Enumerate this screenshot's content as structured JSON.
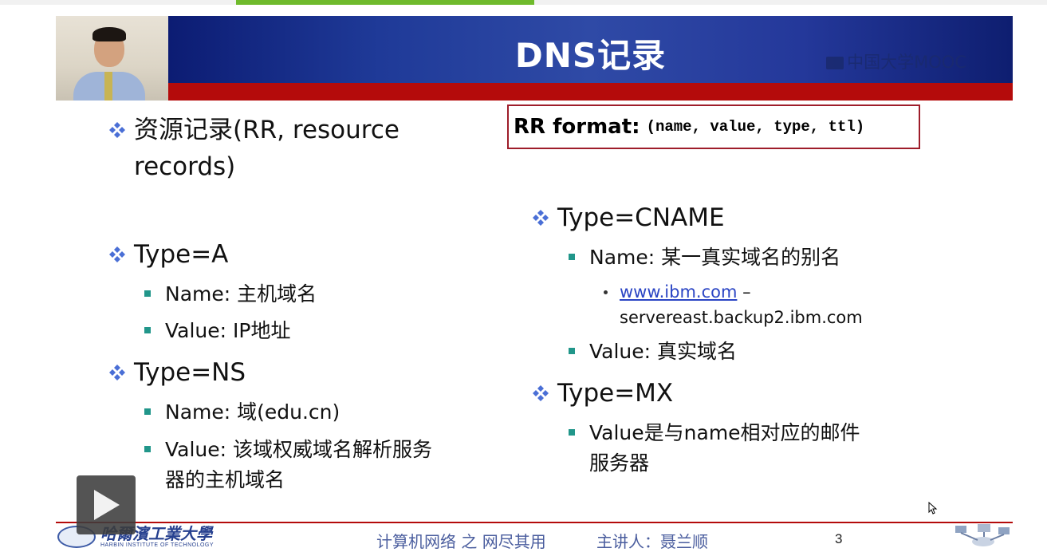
{
  "slide": {
    "title": "DNS记录",
    "watermark": "中国大学MOOC",
    "rr_format": {
      "label": "RR format:",
      "code": "(name, value, type, ttl)"
    },
    "left": {
      "rr_line1": "资源记录(RR, resource",
      "rr_line2": "records)",
      "type_a": "Type=A",
      "type_a_name": "Name: 主机域名",
      "type_a_value": "Value: IP地址",
      "type_ns": "Type=NS",
      "type_ns_name": "Name: 域(edu.cn)",
      "type_ns_value_line1": "Value: 该域权威域名解析服务",
      "type_ns_value_line2": "器的主机域名"
    },
    "right": {
      "type_cname": "Type=CNAME",
      "type_cname_name": "Name: 某一真实域名的别名",
      "example_link": "www.ibm.com",
      "example_dash": " –",
      "example_target": "servereast.backup2.ibm.com",
      "type_cname_value": "Value: 真实域名",
      "type_mx": "Type=MX",
      "type_mx_value_line1": "Value是与name相对应的邮件",
      "type_mx_value_line2": "服务器"
    },
    "footer": {
      "university_zh": "哈爾濱工業大學",
      "university_en": "HARBIN INSTITUTE OF TECHNOLOGY",
      "course": "计算机网络 之 网尽其用",
      "presenter": "主讲人：聂兰顺",
      "page_number": "3"
    }
  },
  "player": {
    "progress": 0.5,
    "play_icon": "play-icon"
  },
  "colors": {
    "header_blue": "#1f3a98",
    "header_red": "#b40b0b",
    "bullet_diamond": "#4a6fd6",
    "bullet_square": "#21968a",
    "link": "#2b45c4",
    "progress_green": "#6fba2c"
  }
}
